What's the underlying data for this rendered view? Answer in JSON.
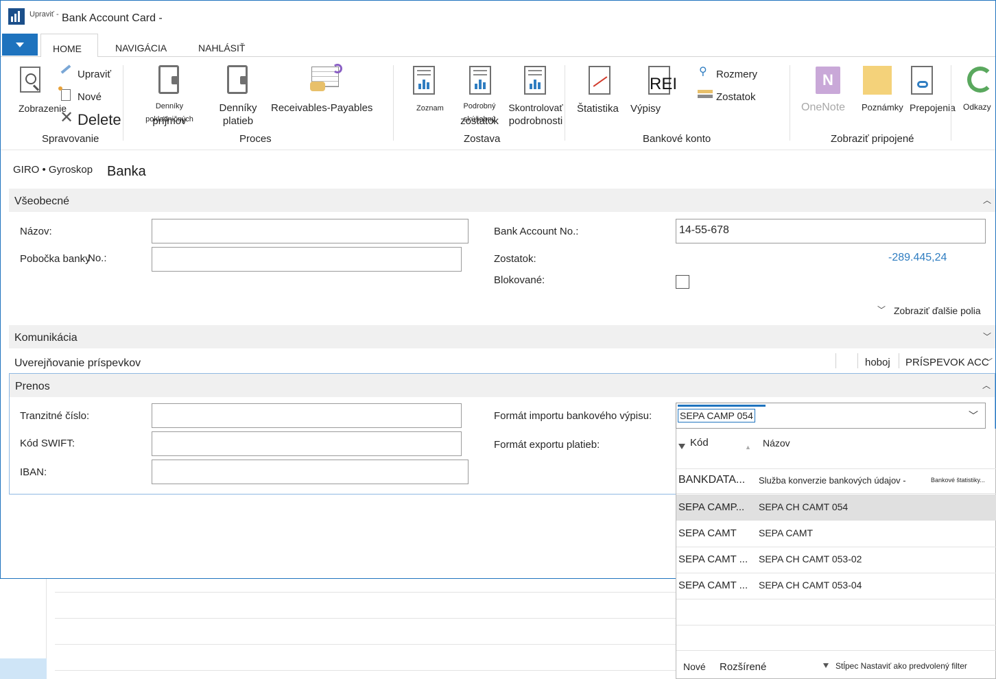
{
  "window": {
    "edit_mode": "Upraviť -",
    "title": "Bank Account Card -"
  },
  "ribbon": {
    "tabs": [
      {
        "label": "HOME",
        "active": true
      },
      {
        "label": "NAVIGÁCIA",
        "active": false
      },
      {
        "label": "NAHLÁSIŤ",
        "active": false
      }
    ],
    "groups": {
      "spravovanie": {
        "label": "Spravovanie",
        "zobrazenie": "Zobrazenie",
        "upravit": "Upraviť",
        "nove": "Nové",
        "delete": "Delete"
      },
      "proces": {
        "label": "Proces",
        "denniky_prijmov_line1": "Denníky pokladničných",
        "denniky_prijmov_line2": "príjmov",
        "denniky_platieb_line1": "Denníky",
        "denniky_platieb_line2": "platieb",
        "receivables": "Receivables-Payables"
      },
      "zostava": {
        "label": "Zostava",
        "zoznam": "Zoznam",
        "podrobny_line1": "Podrobný skúšobný",
        "podrobny_line2": "zostatok",
        "skontrolovat_line1": "Skontrolovať",
        "skontrolovat_line2": "podrobnosti"
      },
      "bankove_konto": {
        "label": "Bankové konto",
        "statistika": "Štatistika",
        "vypisy": "Výpisy",
        "rei": "REI",
        "rozmery": "Rozmery",
        "zostatok": "Zostatok"
      },
      "zobrazit_pripojene": {
        "label": "Zobraziť pripojené",
        "onenote": "OneNote",
        "poznamky": "Poznámky",
        "prepojenia": "Prepojenia",
        "odkazy": "Odkazy"
      }
    }
  },
  "breadcrumb": "GIRO • Gyroskop",
  "heading": "Banka",
  "sections": {
    "vseobecne": {
      "title": "Všeobecné",
      "nazov_label": "Názov:",
      "nazov_value": "",
      "pobocka_label": "Pobočka banky",
      "pobocka_suffix": "No.:",
      "pobocka_value": "",
      "account_no_label": "Bank Account No.:",
      "account_no_value": "14-55-678",
      "zostatok_label": "Zostatok:",
      "zostatok_value": "-289.445,24",
      "blokovane_label": "Blokované:",
      "blokovane_checked": false,
      "show_more": "Zobraziť ďalšie polia"
    },
    "komunikacia": {
      "title": "Komunikácia"
    },
    "uverejnovanie": {
      "title": "Uverejňovanie príspevkov",
      "col1": "hoboj",
      "col2": "PRÍSPEVOK ACC"
    },
    "prenos": {
      "title": "Prenos",
      "tranzitne_label": "Tranzitné číslo:",
      "swift_label": "Kód SWIFT:",
      "iban_label": "IBAN:",
      "import_format_label": "Formát importu bankového výpisu:",
      "import_format_value": "SEPA CAMP 054",
      "export_format_label": "Formát exportu platieb:"
    }
  },
  "lookup": {
    "col_code": "Kód",
    "col_name": "Názov",
    "rows": [
      {
        "code": "BANKDATA...",
        "name": "Služba konverzie bankových údajov -",
        "extra": "Bankové štatistiky...",
        "selected": false
      },
      {
        "code": "SEPA CAMP...",
        "name": "SEPA CH CAMT 054",
        "extra": "",
        "selected": true
      },
      {
        "code": "SEPA CAMT",
        "name": "SEPA CAMT",
        "extra": "",
        "selected": false
      },
      {
        "code": "SEPA CAMT ...",
        "name": "SEPA CH CAMT 053-02",
        "extra": "",
        "selected": false
      },
      {
        "code": "SEPA CAMT ...",
        "name": "SEPA CH CAMT 053-04",
        "extra": "",
        "selected": false
      }
    ],
    "footer_new": "Nové",
    "footer_advanced": "Rozšírené",
    "footer_filter": "Stĺpec Nastaviť ako predvolený filter"
  },
  "colors": {
    "accent": "#1e73be",
    "negative_amount": "#2f7dc1"
  }
}
